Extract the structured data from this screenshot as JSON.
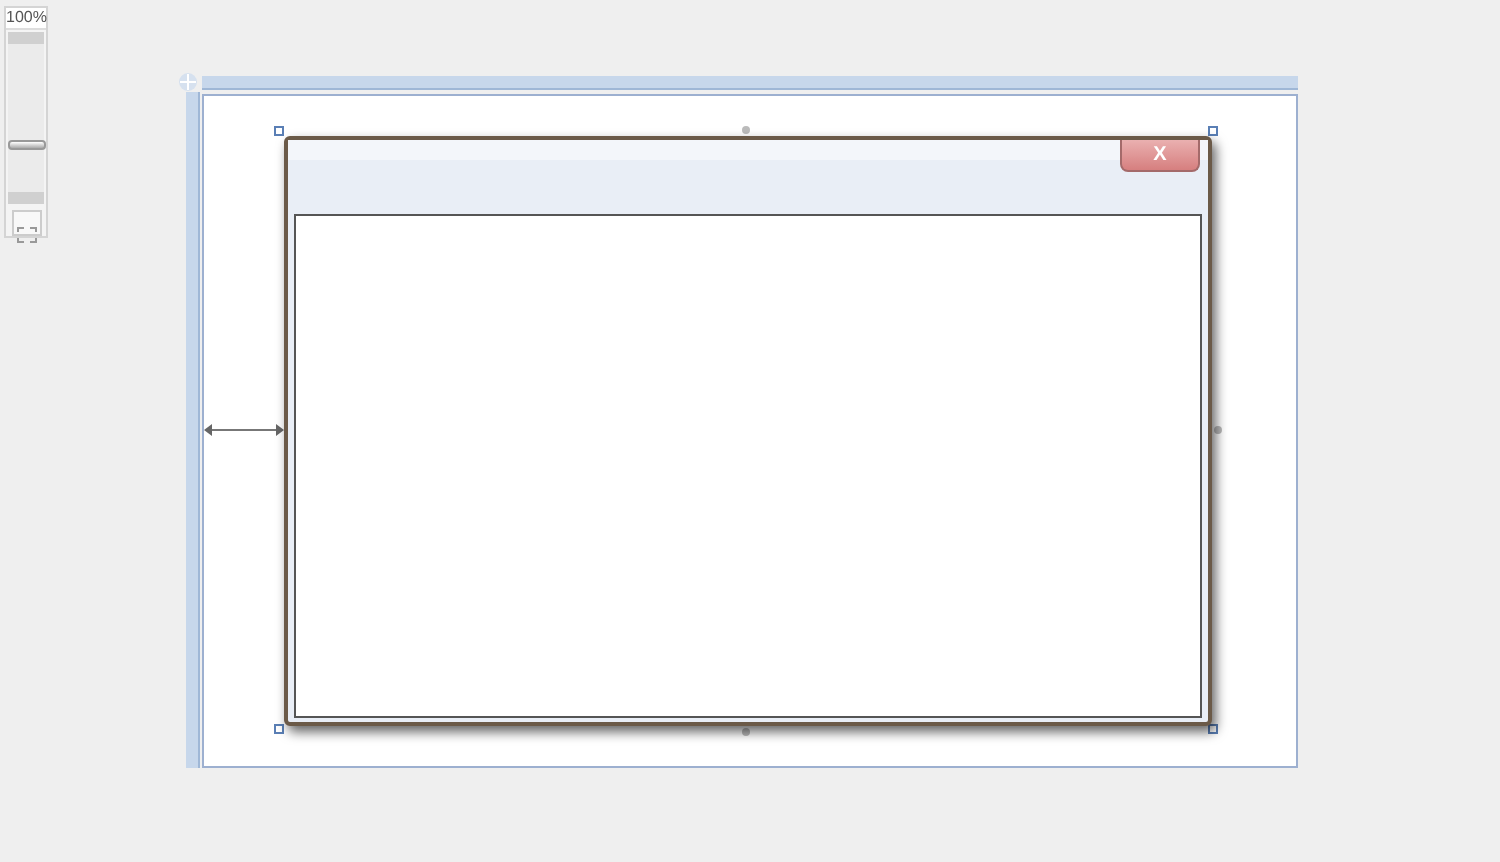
{
  "zoom": {
    "label": "100%",
    "level": 0.35
  },
  "window": {
    "close_button": {
      "label": "X"
    }
  }
}
